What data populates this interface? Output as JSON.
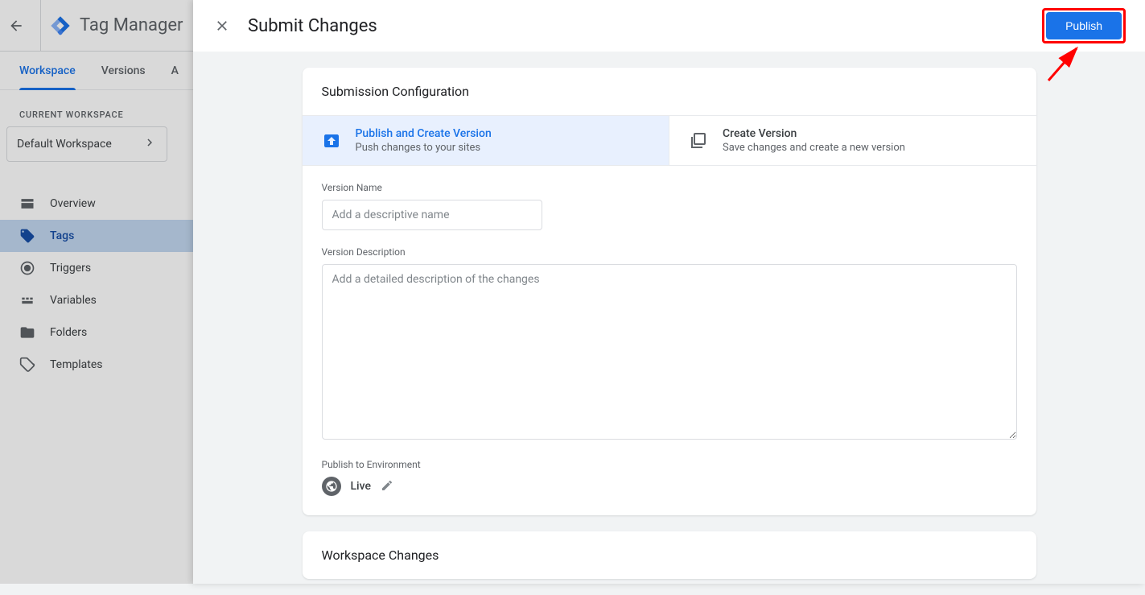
{
  "bg": {
    "app_title": "Tag Manager",
    "tabs": {
      "workspace": "Workspace",
      "versions": "Versions",
      "admin": "A"
    },
    "current_workspace_label": "CURRENT WORKSPACE",
    "workspace_name": "Default Workspace",
    "nav": {
      "overview": "Overview",
      "tags": "Tags",
      "triggers": "Triggers",
      "variables": "Variables",
      "folders": "Folders",
      "templates": "Templates"
    }
  },
  "panel": {
    "title": "Submit Changes",
    "publish_button": "Publish",
    "card1_title": "Submission Configuration",
    "option_publish": {
      "title": "Publish and Create Version",
      "sub": "Push changes to your sites"
    },
    "option_create": {
      "title": "Create Version",
      "sub": "Save changes and create a new version"
    },
    "version_name_label": "Version Name",
    "version_name_placeholder": "Add a descriptive name",
    "version_desc_label": "Version Description",
    "version_desc_placeholder": "Add a detailed description of the changes",
    "publish_env_label": "Publish to Environment",
    "env_name": "Live",
    "card2_title": "Workspace Changes"
  }
}
